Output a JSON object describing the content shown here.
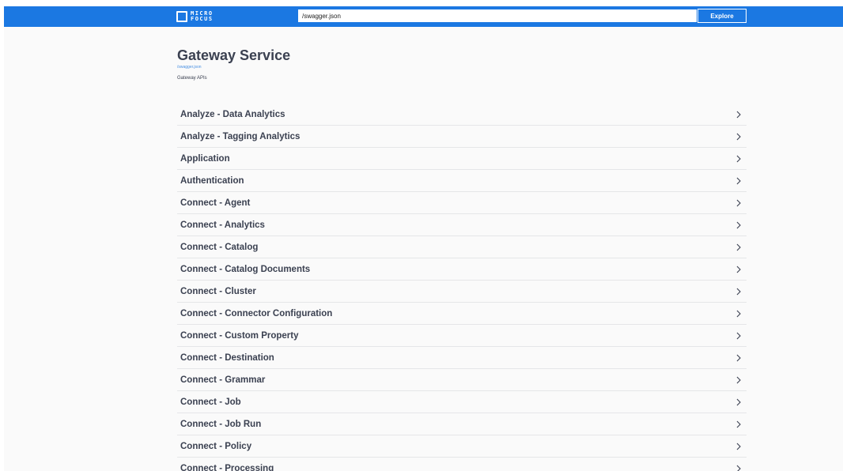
{
  "logo": {
    "line1": "MICRO",
    "line2": "FOCUS"
  },
  "search": {
    "value": "/swagger.json",
    "button_label": "Explore"
  },
  "info": {
    "title": "Gateway Service",
    "spec_url": "/swagger.json",
    "description": "Gateway APIs"
  },
  "tags": [
    {
      "label": "Analyze - Data Analytics"
    },
    {
      "label": "Analyze - Tagging Analytics"
    },
    {
      "label": "Application"
    },
    {
      "label": "Authentication"
    },
    {
      "label": "Connect - Agent"
    },
    {
      "label": "Connect - Analytics"
    },
    {
      "label": "Connect - Catalog"
    },
    {
      "label": "Connect - Catalog Documents"
    },
    {
      "label": "Connect - Cluster"
    },
    {
      "label": "Connect - Connector Configuration"
    },
    {
      "label": "Connect - Custom Property"
    },
    {
      "label": "Connect - Destination"
    },
    {
      "label": "Connect - Grammar"
    },
    {
      "label": "Connect - Job"
    },
    {
      "label": "Connect - Job Run"
    },
    {
      "label": "Connect - Policy"
    },
    {
      "label": "Connect - Processing"
    }
  ],
  "colors": {
    "topbar": "#1b78e2",
    "heading": "#3b4151",
    "link": "#4990e2"
  },
  "icons": {
    "tag_expand": "chevron-right-icon",
    "logo": "micro-focus-logo-icon"
  }
}
